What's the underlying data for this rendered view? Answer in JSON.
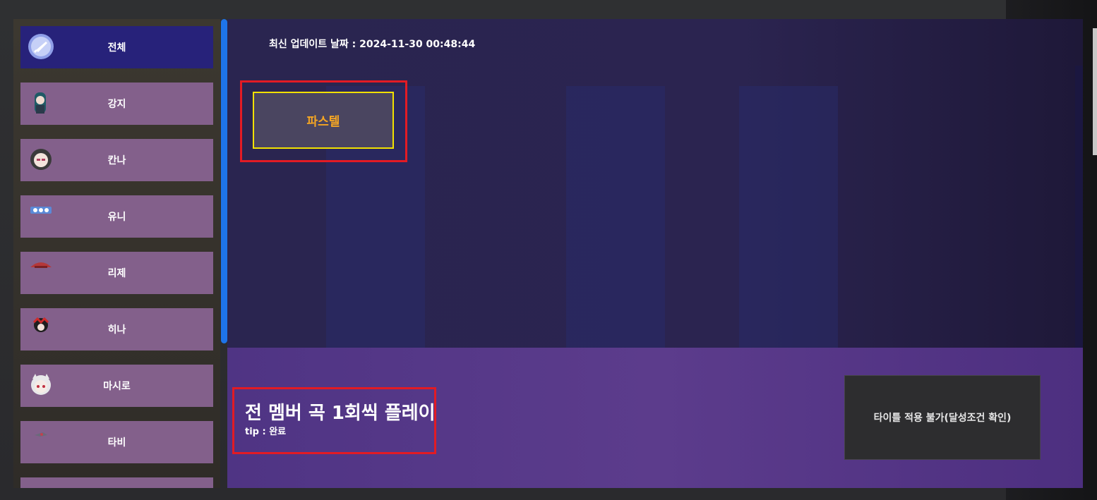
{
  "sidebar": {
    "items": [
      {
        "label": "전체",
        "icon": "all-icon",
        "active": true
      },
      {
        "label": "강지",
        "icon": "gangji-avatar-icon",
        "active": false
      },
      {
        "label": "칸나",
        "icon": "kanna-avatar-icon",
        "active": false
      },
      {
        "label": "유니",
        "icon": "yuni-avatar-icon",
        "active": false
      },
      {
        "label": "리제",
        "icon": "lize-avatar-icon",
        "active": false
      },
      {
        "label": "히나",
        "icon": "hina-avatar-icon",
        "active": false
      },
      {
        "label": "마시로",
        "icon": "mashiro-avatar-icon",
        "active": false
      },
      {
        "label": "타비",
        "icon": "tabi-avatar-icon",
        "active": false
      }
    ]
  },
  "main": {
    "update_text": "최신 업데이트 날짜 : 2024-11-30 00:48:44",
    "selected_title": "파스텔",
    "quest": {
      "title": "전 멤버 곡 1회씩 플레이",
      "tip": "tip : 완료"
    },
    "apply_button_label": "타이틀 적용 불가(달성조건 확인)"
  },
  "colors": {
    "accent_highlight": "#e21b24",
    "selected_border": "#f2e100",
    "title_text": "#f5a623",
    "sidebar_item": "#83608b",
    "sidebar_active": "#27227a",
    "scrollbar": "#1e74e9"
  }
}
